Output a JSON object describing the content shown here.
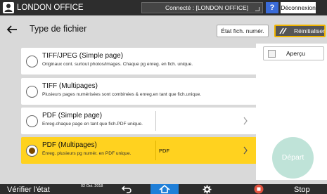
{
  "topbar": {
    "title": "LONDON OFFICE",
    "connection": "Connecté : [LONDON OFFICE]",
    "help_label": "?",
    "logout_label": "Déconnexion"
  },
  "header": {
    "title": "Type de fichier",
    "scan_state_label": "État fich. numér.",
    "reset_label": "Réinitialiser"
  },
  "options": [
    {
      "title": "TIFF/JPEG (Simple page)",
      "desc": "Originaux cont. surtout photos/images. Chaque pg enreg. en fich. unique.",
      "selected": false
    },
    {
      "title": "TIFF (Multipages)",
      "desc": "Plusieurs pages numérisées sont combinées & enreg.en tant que fich.unique.",
      "selected": false
    },
    {
      "title": "PDF (Simple page)",
      "desc": "Enreg.chaque page en tant que fich.PDF unique.",
      "value": "",
      "selected": false
    },
    {
      "title": "PDF (Multipages)",
      "desc": "Enreg. plusieurs pg numér. en PDF unique.",
      "value": "PDF",
      "selected": true
    }
  ],
  "right": {
    "preview_label": "Aperçu",
    "start_label": "Départ"
  },
  "bottombar": {
    "verify_label": "Vérifier l'état",
    "date": "02 Oct. 2018",
    "stop_label": "Stop"
  },
  "colors": {
    "selected_option": "#ffd21f",
    "accent_blue": "#1f7fd8",
    "reset_border": "#f0b400",
    "start_button": "#bfe3d8"
  }
}
